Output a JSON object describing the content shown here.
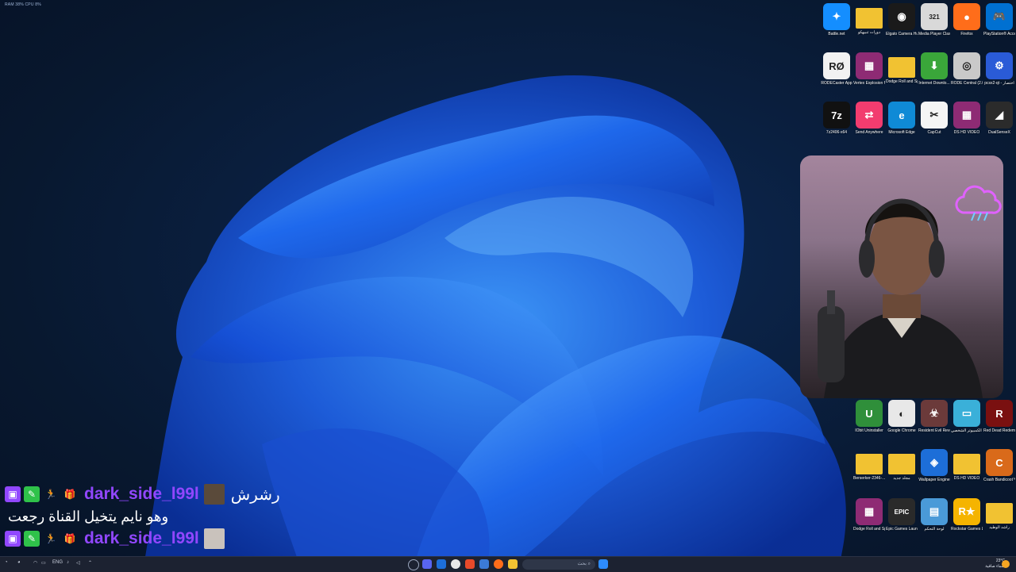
{
  "status_overlay": {
    "text": "RAM 38% CPU 8%"
  },
  "desktop_icons": [
    {
      "label": "Battle.net",
      "color": "#148eff",
      "glyph": "✦"
    },
    {
      "label": "دورات تنبيهكو",
      "color": "#f1c232",
      "glyph": ""
    },
    {
      "label": "Elgato Camera Hub",
      "color": "#1a1a1a",
      "glyph": "◉"
    },
    {
      "label": "Media Player Classic",
      "color": "#d9d9d9",
      "glyph": "321"
    },
    {
      "label": "Firefox",
      "color": "#ff6d1a",
      "glyph": "●"
    },
    {
      "label": "PlayStation® Accessories",
      "color": "#0070d1",
      "glyph": "🎮"
    },
    {
      "label": "RODECaster App",
      "color": "#f2f2f2",
      "glyph": "RØ"
    },
    {
      "label": "Vertex Explosion fix-109-1-0-17...",
      "color": "#8e2b74",
      "glyph": "▦"
    },
    {
      "label": "Dodge Roll and Sprint-496-2-30...",
      "color": "#f1c232",
      "glyph": ""
    },
    {
      "label": "Internet Downlo...",
      "color": "#3aa63a",
      "glyph": "⬇"
    },
    {
      "label": "RODE Central (2.0.65)",
      "color": "#c9c9c9",
      "glyph": "◎"
    },
    {
      "label": "pcsx2-qt - اختصار",
      "color": "#2a5bd7",
      "glyph": "⚙"
    },
    {
      "label": "7z2406-x64",
      "color": "#111111",
      "glyph": "7z"
    },
    {
      "label": "Send Anywhere",
      "color": "#f23c6f",
      "glyph": "⇄"
    },
    {
      "label": "Microsoft Edge",
      "color": "#0f8ad6",
      "glyph": "e"
    },
    {
      "label": "CapCut",
      "color": "#f5f5f5",
      "glyph": "✂"
    },
    {
      "label": "DS HD VIDEO",
      "color": "#8e2b74",
      "glyph": "▦"
    },
    {
      "label": "DualSenseX",
      "color": "#2b2b2b",
      "glyph": "◢"
    },
    {
      "label": "IObit Uninstaller",
      "color": "#2f8f3a",
      "glyph": "U"
    },
    {
      "label": "Google Chrome",
      "color": "#e8e8e8",
      "glyph": "◐"
    },
    {
      "label": "Resident Evil Revelations...",
      "color": "#6b3a3a",
      "glyph": "☣"
    },
    {
      "label": "هذا الكمبيوتر الشخصي",
      "color": "#3ab0d9",
      "glyph": "▭"
    },
    {
      "label": "Red Dead Redemption 2",
      "color": "#7a1010",
      "glyph": "R"
    },
    {
      "label": "Berserker-2346-...",
      "color": "#f1c232",
      "glyph": ""
    },
    {
      "label": "مجلد جديد",
      "color": "#f1c232",
      "glyph": ""
    },
    {
      "label": "Wallpaper Engine",
      "color": "#1d6ed8",
      "glyph": "◈"
    },
    {
      "label": "DS HD VIDEO",
      "color": "#f1c232",
      "glyph": ""
    },
    {
      "label": "Crash Bandicoot™...",
      "color": "#d96a1a",
      "glyph": "C"
    },
    {
      "label": "Dodge Roll and Sprint-496-2-30...",
      "color": "#8e2b74",
      "glyph": "▦"
    },
    {
      "label": "Epic Games Launcher",
      "color": "#2a2a2a",
      "glyph": "EPIC"
    },
    {
      "label": "لوحة التحكم",
      "color": "#4a9ad8",
      "glyph": "▤"
    },
    {
      "label": "Rockstar Games Launcher",
      "color": "#f5b400",
      "glyph": "R★"
    },
    {
      "label": "راشد الوطيد",
      "color": "#f1c232",
      "glyph": ""
    }
  ],
  "chat": {
    "messages": [
      {
        "user": "dark_side_l99l",
        "message": "رشرش",
        "text_line": "وهو نايم يتخيل القناة رجعت"
      },
      {
        "user": "dark_side_l99l",
        "message": "",
        "text_line": ""
      }
    ]
  },
  "taskbar": {
    "search_placeholder": "بحث",
    "tray_lang": "ENG",
    "clock_time": "٥٣:١٣ م",
    "clock_date": "٢٠٢٤/٠٩/٠٦",
    "weather": "23°C",
    "weather_note": "سماء صافية"
  }
}
